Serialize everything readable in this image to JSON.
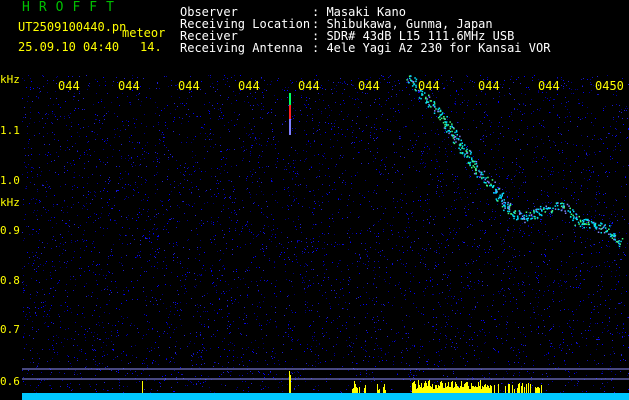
{
  "header": {
    "logo": "HROFFT",
    "filename": "UT2509100440.pn",
    "mode": "meteor",
    "datetime": "25.09.10 04:40",
    "extra": "14.",
    "fields": [
      {
        "label": "Observer",
        "value": ": Masaki Kano"
      },
      {
        "label": "Receiving Location",
        "value": ": Shibukawa, Gunma, Japan"
      },
      {
        "label": "Receiver",
        "value": ": SDR# 43dB L15 111.6MHz USB"
      },
      {
        "label": "Receiving Antenna",
        "value": ": 4ele Yagi Az 230 for Kansai VOR"
      }
    ]
  },
  "axes": {
    "y_unit_top": "kHz",
    "y_unit_mid": "kHz",
    "y_ticks": [
      "1.1",
      "1.0",
      "0.9",
      "0.8",
      "0.7",
      "0.6"
    ],
    "x_ticks": [
      "044",
      "044",
      "044",
      "044",
      "044",
      "044",
      "044",
      "044",
      "044",
      "0450"
    ]
  },
  "colors": {
    "background": "#000000",
    "noise": "#000090",
    "text_yellow": "#ffff00",
    "text_white": "#ffffff",
    "logo_green": "#00c000",
    "baseline_cyan": "#00c8ff"
  }
}
